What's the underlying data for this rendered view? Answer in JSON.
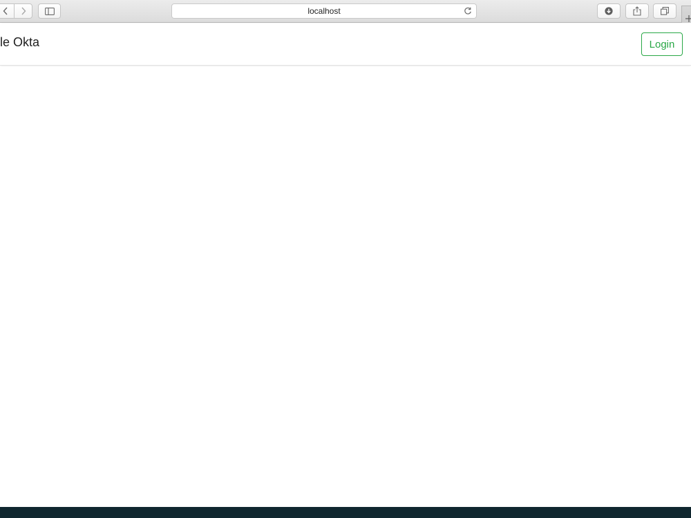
{
  "browser": {
    "url": "localhost",
    "icons": {
      "back": "chevron-left-icon",
      "forward": "chevron-right-icon",
      "sidebar": "sidebar-icon",
      "reload": "reload-icon",
      "downloads": "download-icon",
      "share": "share-icon",
      "tabs": "tabs-icon",
      "new_tab": "plus-icon"
    }
  },
  "navbar": {
    "brand": "ple Okta",
    "login_label": "Login"
  },
  "colors": {
    "accent": "#28a745",
    "footer": "#10272f"
  }
}
